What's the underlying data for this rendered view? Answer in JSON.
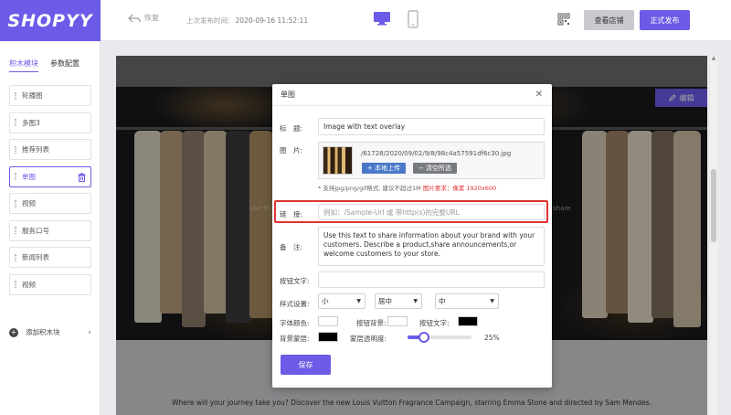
{
  "app": {
    "logo_text": "SHOPYY"
  },
  "header": {
    "undo_label": "恢复",
    "last_publish_label": "上次发布时间:",
    "last_publish_time": "2020-09-16 11:52:11",
    "view_store_label": "查看店铺",
    "publish_label": "正式发布"
  },
  "sidebar": {
    "tabs": [
      {
        "label": "积木模块",
        "active": true
      },
      {
        "label": "参数配置",
        "active": false
      }
    ],
    "blocks": [
      {
        "label": "轮播图"
      },
      {
        "label": "多图3"
      },
      {
        "label": "推荐列表"
      },
      {
        "label": "单图",
        "active": true
      },
      {
        "label": "视频"
      },
      {
        "label": "服务口号"
      },
      {
        "label": "新闻列表"
      },
      {
        "label": "视频"
      }
    ],
    "add_block_label": "添加积木块"
  },
  "preview": {
    "edit_label": "编辑",
    "hero_text_left": "Use th",
    "hero_text_right": "share",
    "caption": "Where will your journey take you? Discover the new Louis Vuitton Fragrance Campaign, starring Emma Stone and directed by Sam Mendes."
  },
  "modal": {
    "title": "单图",
    "fields": {
      "title_label": "标　题:",
      "title_value": "Image with text overlay",
      "image_label": "图　片:",
      "image_path": "/61728/2020/09/02/9/8/98c4a57591df6c30.jpg",
      "upload_label": "+ 本地上传",
      "clear_label": "− 清空所选",
      "hint_text": "* 支持jpg/png/gif格式, 建议不超过1M",
      "hint_size": "图片要求：像素 1920x600",
      "link_label": "链　接:",
      "link_placeholder": "例如：/Sample-Url 或 带http(s)的完整URL",
      "note_label": "备　注:",
      "note_value": "Use this text to share information about your brand with your customers. Describe a product,share announcements,or welcome customers to your store.",
      "button_text_label": "按钮文字:",
      "button_text_value": ""
    },
    "style": {
      "label": "样式设置:",
      "size_value": "小",
      "align_value": "居中",
      "weight_value": "中",
      "font_color_label": "字体颜色:",
      "button_bg_label": "按钮背景:",
      "button_text_color_label": "按钮文字:",
      "bg_overlay_label": "背景蒙层:",
      "overlay_opacity_label": "蒙层透明度:",
      "overlay_opacity_value": "25%",
      "overlay_opacity": 0.25
    },
    "save_label": "保存"
  },
  "colors": {
    "accent": "#6b5be6",
    "highlight": "#e03434",
    "font_color": "#ffffff",
    "button_bg": "#ffffff",
    "button_text": "#000000",
    "bg_overlay": "#000000"
  }
}
